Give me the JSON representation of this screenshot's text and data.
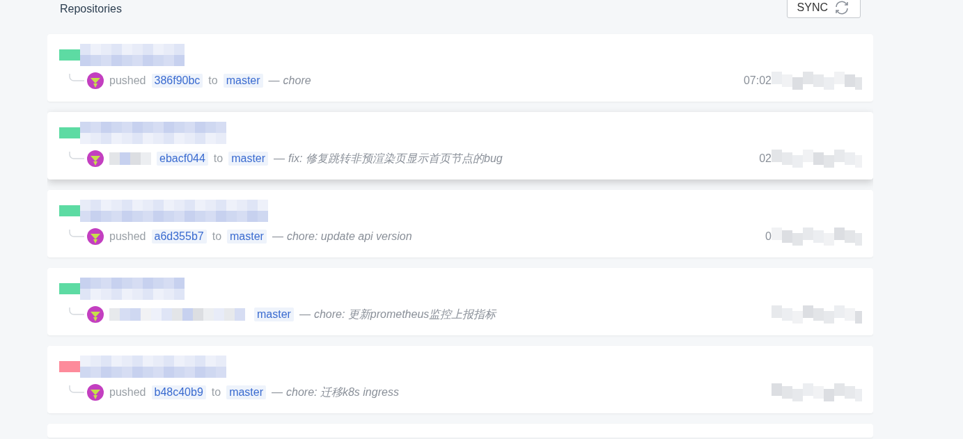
{
  "header": {
    "title": "Repositories",
    "sync_button": "SYNC"
  },
  "repositories": [
    {
      "color": "#5ddba3",
      "hovered": false,
      "pushed": "pushed",
      "sha": "386f90bc",
      "to": "to",
      "branch": "master",
      "dash": "—",
      "message": "chore",
      "time": "07:02"
    },
    {
      "color": "#5ddba3",
      "hovered": true,
      "sha": "ebacf044",
      "to": "to",
      "branch": "master",
      "dash": "—",
      "message": "fix: 修复跳转非预渲染页显示首页节点的bug",
      "time": "02"
    },
    {
      "color": "#5ddba3",
      "hovered": false,
      "pushed": "pushed",
      "sha": "a6d355b7",
      "to": "to",
      "branch": "master",
      "dash": "—",
      "message": "chore: update api version",
      "time": "0"
    },
    {
      "color": "#5ddba3",
      "hovered": false,
      "branch": "master",
      "dash": "—",
      "message": "chore: 更新prometheus监控上报指标"
    },
    {
      "color": "#fd8b9b",
      "hovered": false,
      "pushed": "pushed",
      "sha": "b48c40b9",
      "to": "to",
      "branch": "master",
      "dash": "—",
      "message": "chore: 迁移k8s ingress"
    }
  ]
}
